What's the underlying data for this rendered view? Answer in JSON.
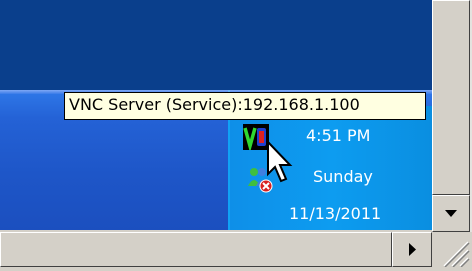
{
  "tooltip": {
    "text": "VNC Server (Service):192.168.1.100"
  },
  "tray": {
    "time": "4:51 PM",
    "day": "Sunday",
    "date": "11/13/2011",
    "icons": [
      "vnc-server-icon",
      "messenger-icon"
    ]
  },
  "colors": {
    "desktop": "#0a3f8c",
    "taskbar": "#1e56c8",
    "tray": "#0d9cf0",
    "tooltip_bg": "#ffffe1"
  },
  "scrollbars": {
    "vertical_down": "down-arrow-icon",
    "horizontal_right": "right-arrow-icon"
  }
}
